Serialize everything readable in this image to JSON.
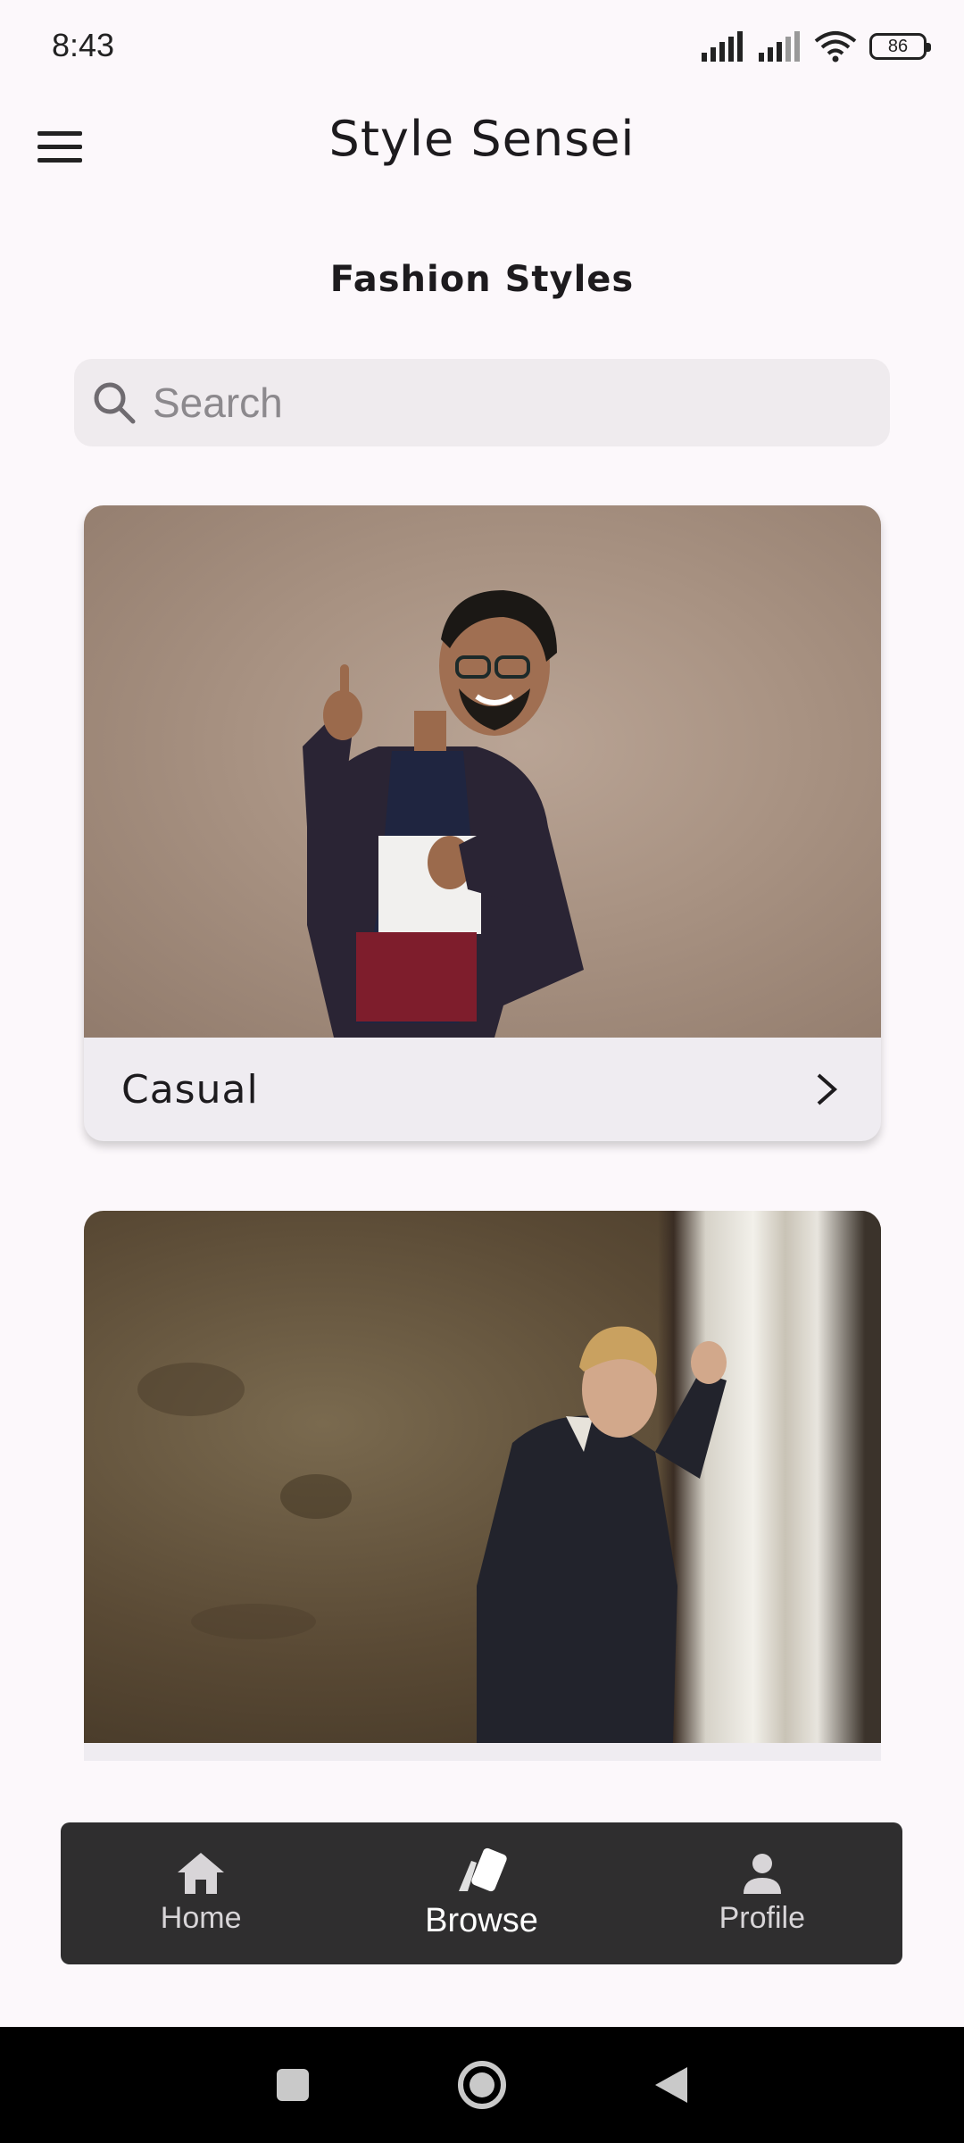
{
  "status_bar": {
    "time": "8:43",
    "battery": "86"
  },
  "app_bar": {
    "title": "Style Sensei"
  },
  "section": {
    "title": "Fashion Styles"
  },
  "search": {
    "placeholder": "Search",
    "value": ""
  },
  "cards": [
    {
      "label": "Casual"
    },
    {
      "label": ""
    }
  ],
  "bottom_nav": {
    "items": [
      {
        "label": "Home",
        "icon": "home-icon"
      },
      {
        "label": "Browse",
        "icon": "browse-cards-icon",
        "active": true
      },
      {
        "label": "Profile",
        "icon": "person-icon"
      }
    ]
  },
  "colors": {
    "background": "#fcf8fb",
    "search_bg": "#efebee",
    "card_bg": "#efecf1",
    "nav_bg": "#2f2e2f"
  }
}
